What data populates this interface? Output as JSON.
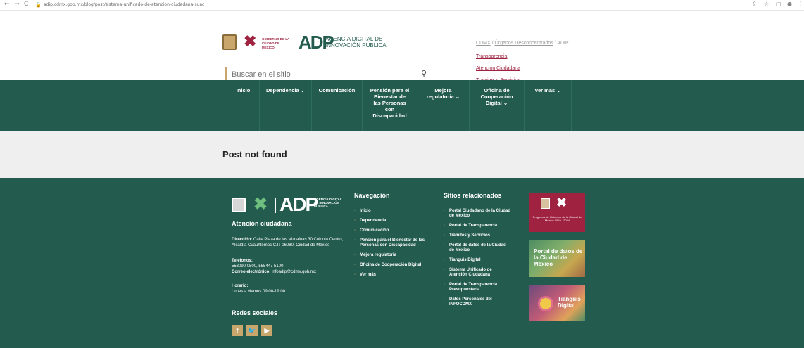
{
  "browser": {
    "back": "←",
    "forward": "→",
    "reload": "C",
    "url": "adip.cdmx.gob.mx/blog/post/sistema-unificado-de-atencion-ciudadana-suac"
  },
  "header": {
    "gob_text": "GOBIERNO DE LA CIUDAD DE MÉXICO",
    "adp_logo": "ADP",
    "agency_name": "AGENCIA DIGITAL DE INNOVACIÓN PÚBLICA",
    "search_placeholder": "Buscar en el sitio",
    "breadcrumb": {
      "cdmx": "CDMX",
      "sep1": " / ",
      "organos": "Órganos Desconcentrados",
      "sep2": " / ",
      "current": "ADIP"
    },
    "links": [
      "Transparencia",
      "Atención Ciudadana",
      "Trámites y Servicios"
    ]
  },
  "nav": {
    "items": [
      {
        "label": "Inicio"
      },
      {
        "label": "Dependencia ⌄"
      },
      {
        "label": "Comunicación"
      },
      {
        "label": "Pensión para el Bienestar de las Personas con Discapacidad"
      },
      {
        "label": "Mejora regulatoria ⌄"
      },
      {
        "label": "Oficina de Cooperación Digital ⌄"
      },
      {
        "label": "Ver más ⌄"
      }
    ]
  },
  "main": {
    "message": "Post not found"
  },
  "footer": {
    "adp_logo": "ADP",
    "agency_name": "AGENCIA DIGITAL DE INNOVACIÓN PÚBLICA",
    "attention_title": "Atención ciudadana",
    "address_label": "Dirección:",
    "address_value": "Calle Plaza de las Vizcaínas 30 Colonia Centro, Alcaldía Cuauhtémoc C.P. 06080, Ciudad de México",
    "phones_label": "Teléfonos:",
    "phones_value": "553090 0500, 555447 5100",
    "email_label": "Correo electrónico:",
    "email_value": "infoadip@cdmx.gob.mx",
    "schedule_label": "Horario:",
    "schedule_value": "Lunes a viernes 09:00-19:00",
    "social_title": "Redes sociales",
    "nav_title": "Navegación",
    "nav_links": [
      "Inicio",
      "Dependencia",
      "Comunicación",
      "Pensión para el Bienestar de las Personas con Discapacidad",
      "Mejora regulatoria",
      "Oficina de Cooperación Digital",
      "Ver más"
    ],
    "related_title": "Sitios relacionados",
    "related_links": [
      "Portal Ciudadano de la Ciudad de México",
      "Portal de Transparencia",
      "Trámites y Servicios",
      "Portal de datos de la Ciudad de México",
      "Tianguis Digital",
      "Sistema Unificado de Atención Ciudadana",
      "Portal de Transparencia Presupuestaria",
      "Datos Personales del INFOCDMX"
    ],
    "card1_text": "Programa de Gobierno de la Ciudad de México 2019 - 2024",
    "card2_text": "Portal de datos de la Ciudad de México",
    "card3_text": "Tianguis Digital"
  }
}
